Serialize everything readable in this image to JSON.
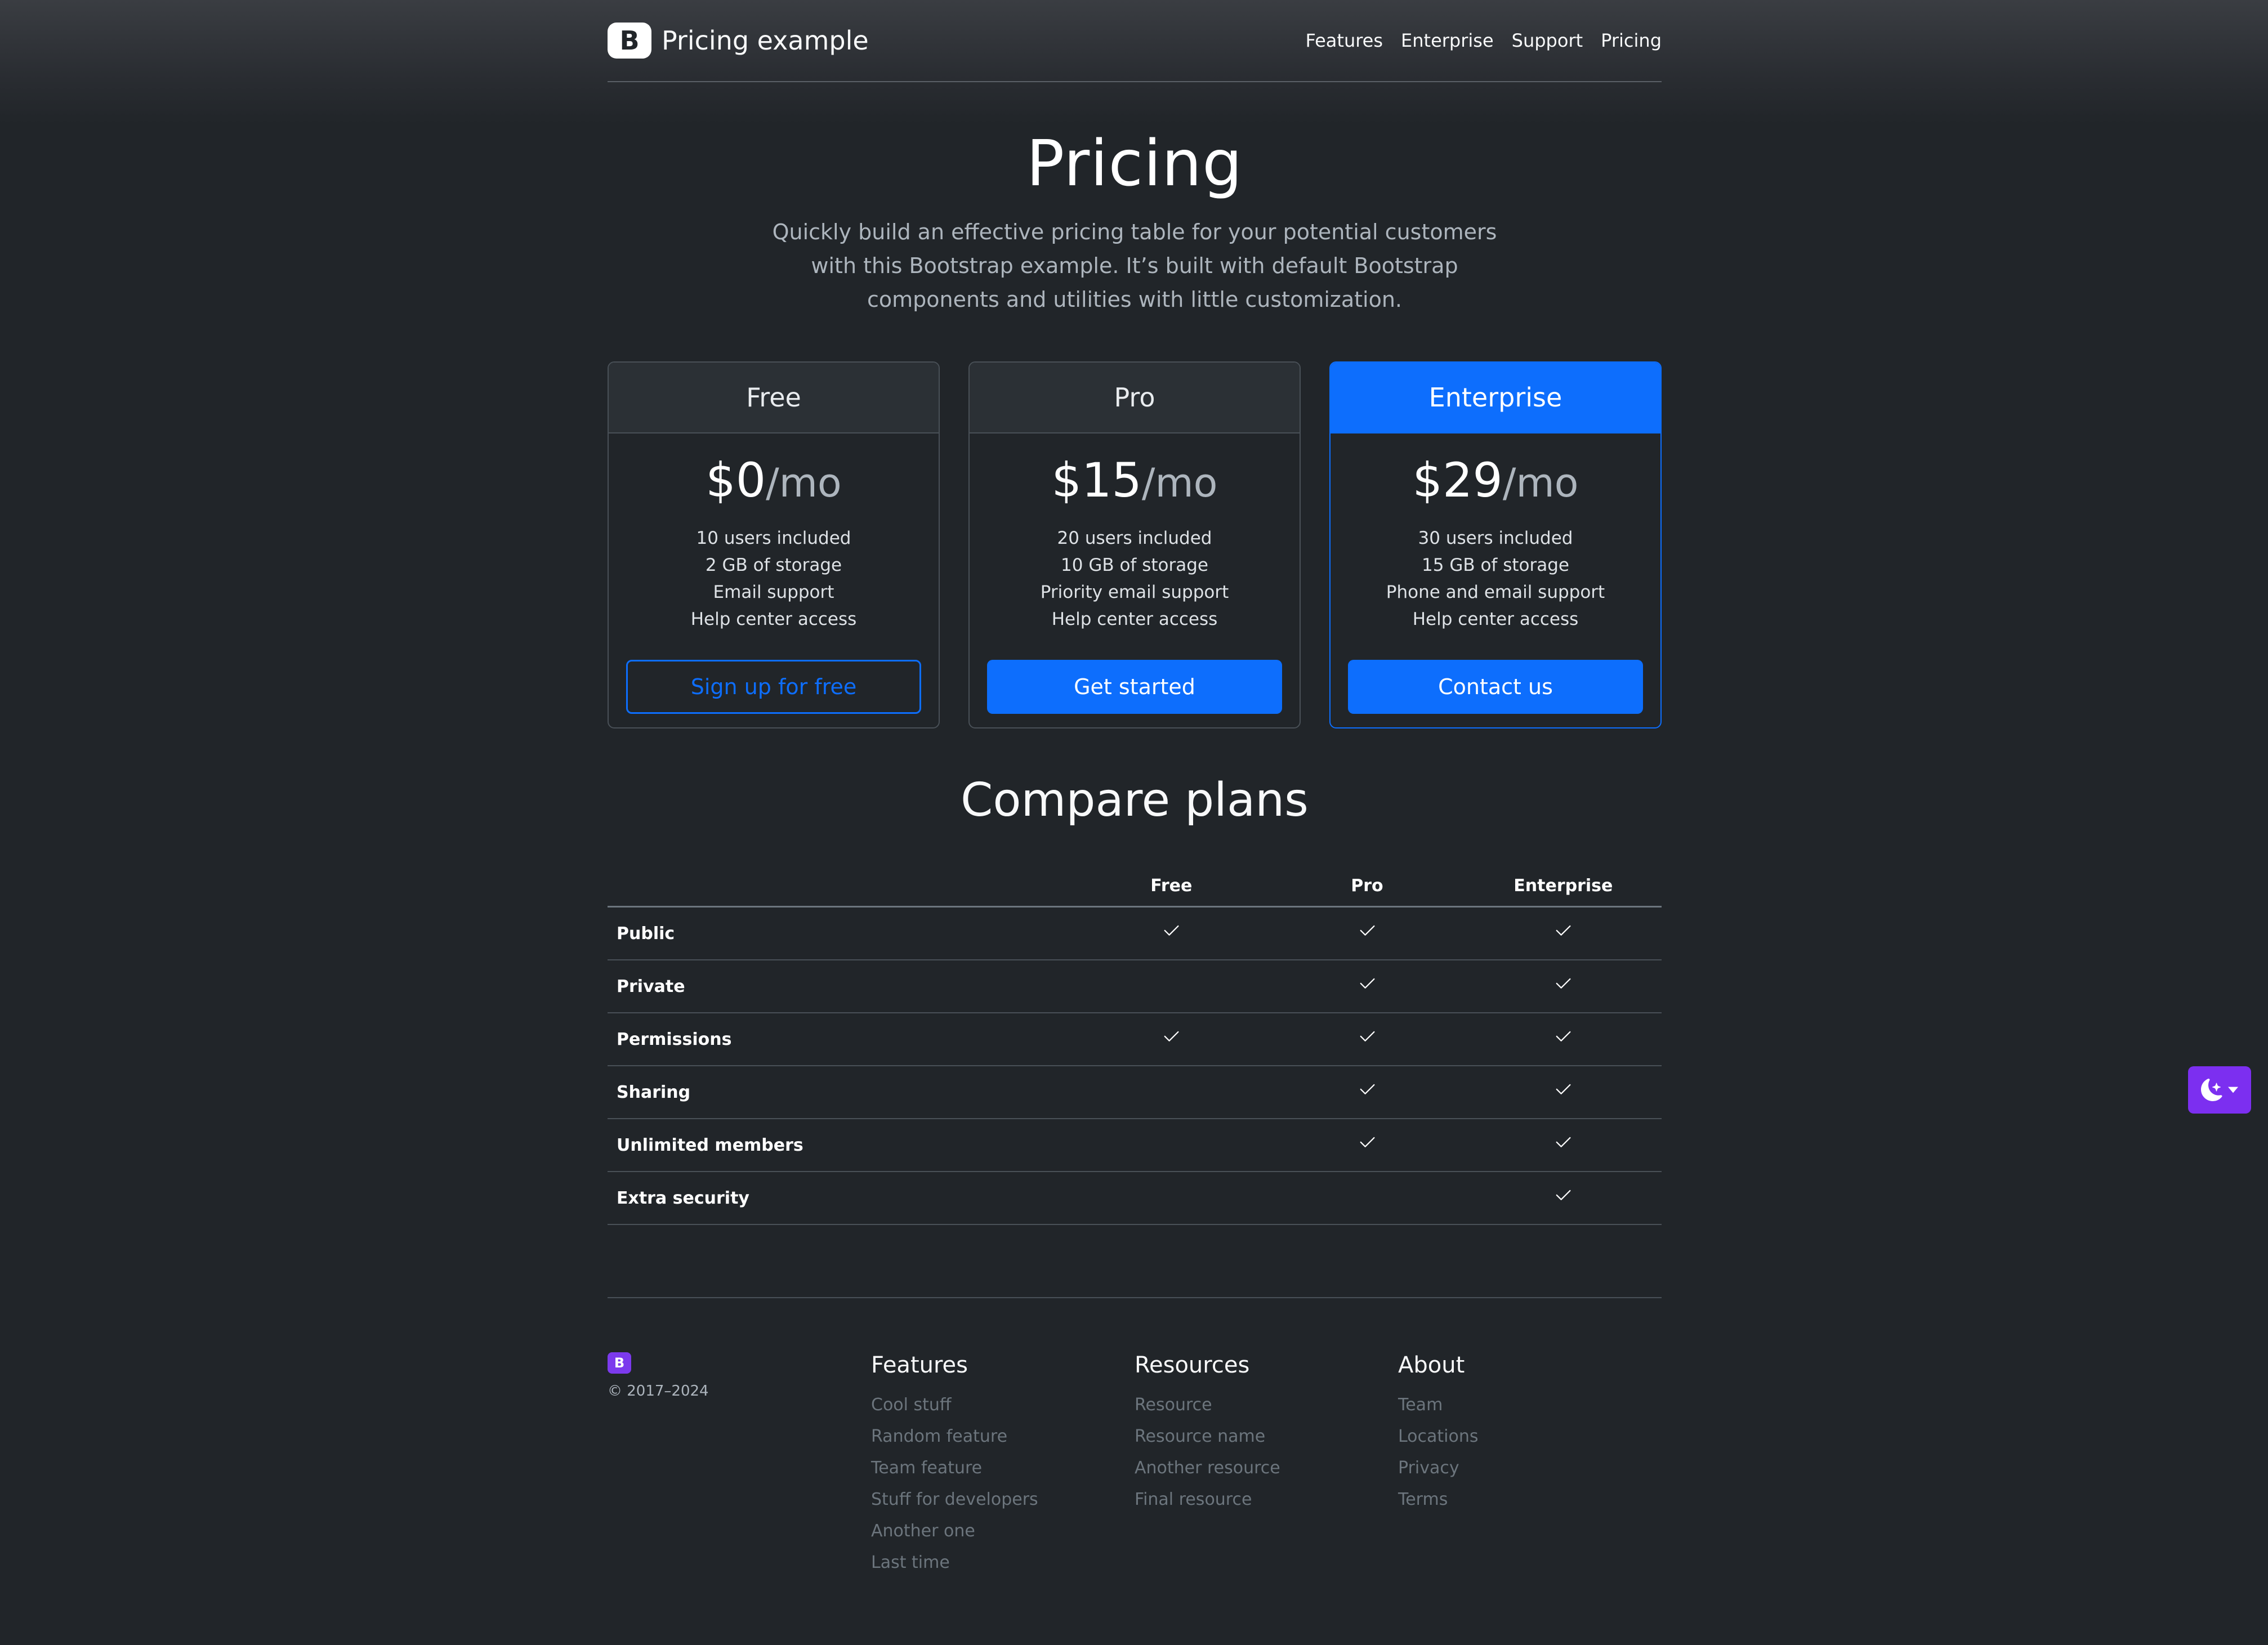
{
  "header": {
    "brand_letter": "B",
    "brand_name": "Pricing example",
    "nav": [
      "Features",
      "Enterprise",
      "Support",
      "Pricing"
    ]
  },
  "hero": {
    "title": "Pricing",
    "lead": "Quickly build an effective pricing table for your potential customers with this Bootstrap example. It’s built with default Bootstrap components and utilities with little customization."
  },
  "plans": [
    {
      "name": "Free",
      "price": "$0",
      "period": "/mo",
      "features": [
        "10 users included",
        "2 GB of storage",
        "Email support",
        "Help center access"
      ],
      "button": "Sign up for free"
    },
    {
      "name": "Pro",
      "price": "$15",
      "period": "/mo",
      "features": [
        "20 users included",
        "10 GB of storage",
        "Priority email support",
        "Help center access"
      ],
      "button": "Get started"
    },
    {
      "name": "Enterprise",
      "price": "$29",
      "period": "/mo",
      "features": [
        "30 users included",
        "15 GB of storage",
        "Phone and email support",
        "Help center access"
      ],
      "button": "Contact us"
    }
  ],
  "compare": {
    "title": "Compare plans",
    "columns": [
      "Free",
      "Pro",
      "Enterprise"
    ],
    "rows": [
      {
        "label": "Public",
        "checks": [
          true,
          true,
          true
        ]
      },
      {
        "label": "Private",
        "checks": [
          false,
          true,
          true
        ]
      },
      {
        "label": "Permissions",
        "checks": [
          true,
          true,
          true
        ]
      },
      {
        "label": "Sharing",
        "checks": [
          false,
          true,
          true
        ]
      },
      {
        "label": "Unlimited members",
        "checks": [
          false,
          true,
          true
        ]
      },
      {
        "label": "Extra security",
        "checks": [
          false,
          false,
          true
        ]
      }
    ]
  },
  "footer": {
    "logo_letter": "B",
    "copyright": "© 2017–2024",
    "columns": [
      {
        "title": "Features",
        "links": [
          "Cool stuff",
          "Random feature",
          "Team feature",
          "Stuff for developers",
          "Another one",
          "Last time"
        ]
      },
      {
        "title": "Resources",
        "links": [
          "Resource",
          "Resource name",
          "Another resource",
          "Final resource"
        ]
      },
      {
        "title": "About",
        "links": [
          "Team",
          "Locations",
          "Privacy",
          "Terms"
        ]
      }
    ]
  },
  "colors": {
    "background": "#212529",
    "primary": "#0d6efd",
    "theme_toggle": "#7c2ff0"
  },
  "icons": {
    "check": "check-icon",
    "theme": "moon-stars-icon"
  }
}
